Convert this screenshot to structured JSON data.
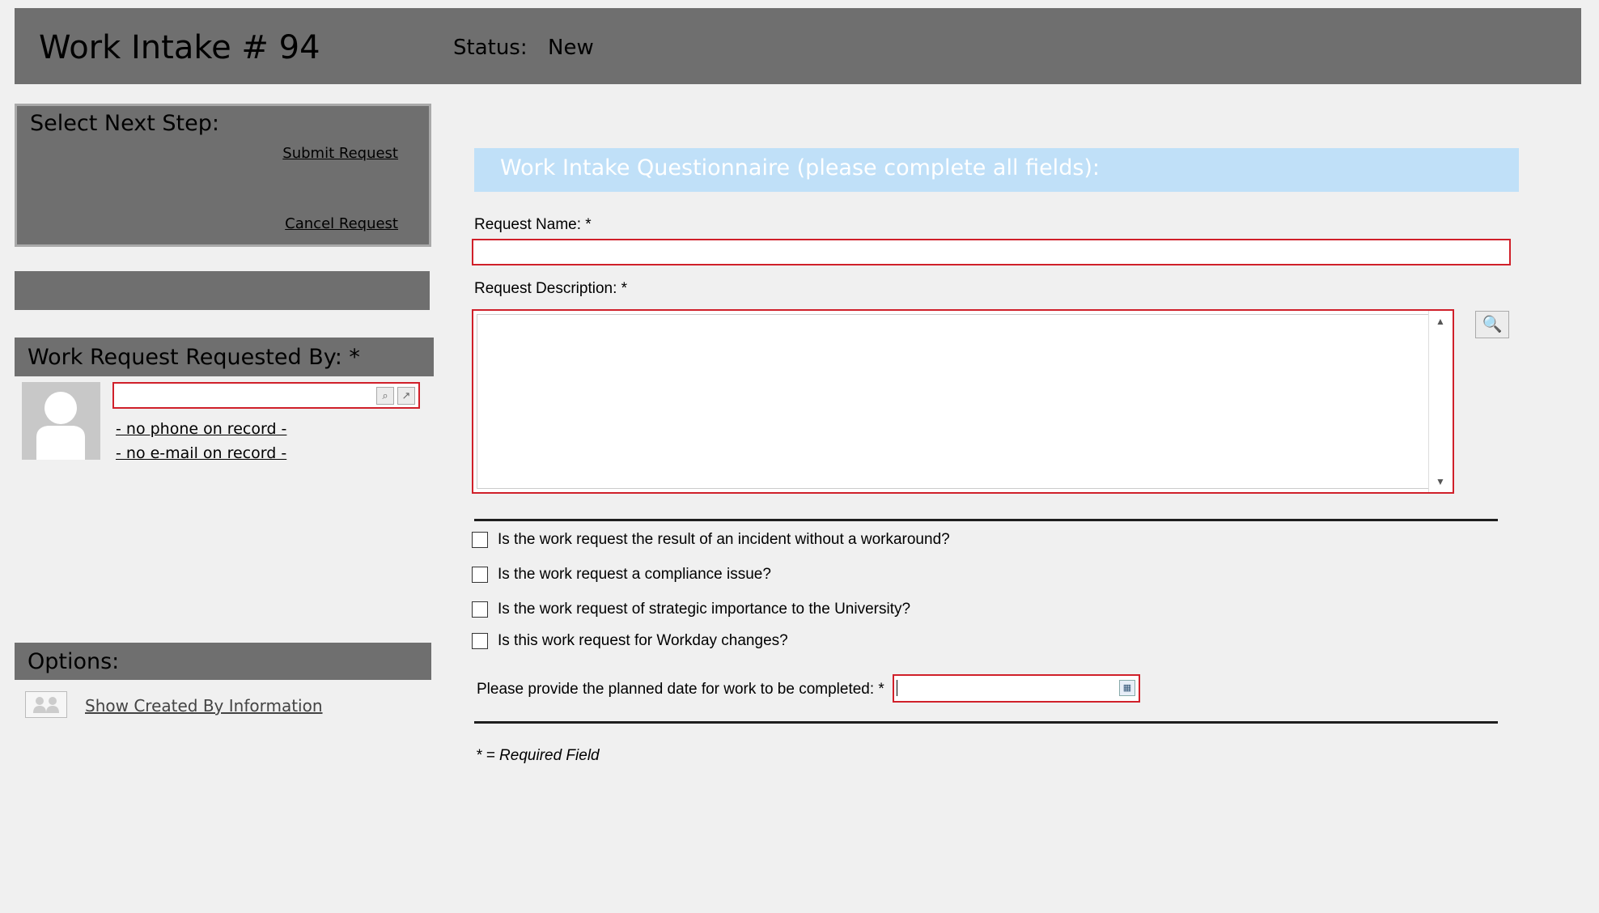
{
  "header": {
    "title": "Work Intake # 94",
    "status_label": "Status:",
    "status_value": "New"
  },
  "next_step": {
    "title": "Select Next Step:",
    "submit_label": "Submit Request",
    "cancel_label": "Cancel Request"
  },
  "requested_by": {
    "title": "Work Request Requested By: *",
    "input_value": "",
    "phone": "- no phone on record -",
    "email": "- no e-mail on record -"
  },
  "options": {
    "title": "Options:",
    "created_by_label": "Show Created By Information"
  },
  "questionnaire": {
    "title": "Work Intake Questionnaire (please complete all fields):",
    "request_name_label": "Request Name: *",
    "request_name_value": "",
    "request_description_label": "Request Description: *",
    "request_description_value": "",
    "questions": [
      {
        "label": "Is the work request the result of an incident without a workaround?",
        "checked": false
      },
      {
        "label": "Is the work request a compliance issue?",
        "checked": false
      },
      {
        "label": "Is the work request of strategic importance to the University?",
        "checked": false
      },
      {
        "label": "Is this work request for Workday changes?",
        "checked": false
      }
    ],
    "planned_date_label": "Please provide the planned date for work to be completed: *",
    "planned_date_value": "",
    "required_note": "* = Required Field"
  },
  "icons": {
    "lookup": "lookup-icon",
    "open": "open-external-icon",
    "zoom": "magnifier-icon",
    "calendar": "calendar-icon",
    "people": "people-icon",
    "avatar": "user-silhouette-icon"
  },
  "colors": {
    "panel": "#6f6f6f",
    "required_border": "#d0202a",
    "questionnaire_header": "#c0e0f8",
    "background": "#f0f0f0"
  }
}
